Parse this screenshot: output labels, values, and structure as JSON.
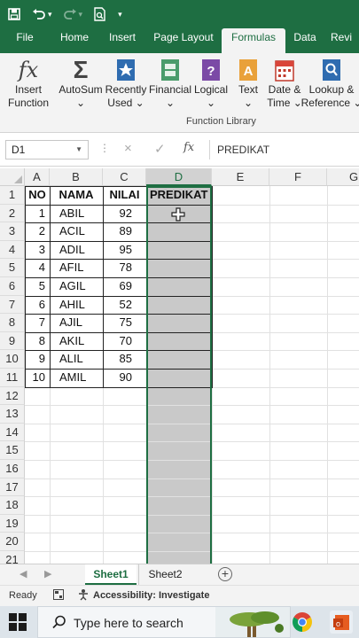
{
  "colors": {
    "accent": "#1e6e42",
    "ribbon_bg": "#f3f3f3",
    "selected_column": "#c9c9c9"
  },
  "qat": {
    "icons": [
      "save-icon",
      "undo-icon",
      "redo-icon",
      "print-preview-icon",
      "customize-caret-icon"
    ]
  },
  "tabs": [
    {
      "label": "File",
      "active": false
    },
    {
      "label": "Home",
      "active": false
    },
    {
      "label": "Insert",
      "active": false
    },
    {
      "label": "Page Layout",
      "active": false
    },
    {
      "label": "Formulas",
      "active": true
    },
    {
      "label": "Data",
      "active": false
    },
    {
      "label": "Revi",
      "active": false
    }
  ],
  "ribbon": {
    "group_label": "Function Library",
    "buttons": [
      {
        "line1": "Insert",
        "line2": "Function",
        "icon": "fx-icon"
      },
      {
        "line1": "AutoSum",
        "line2": "⌄",
        "icon": "sigma-icon"
      },
      {
        "line1": "Recently",
        "line2": "Used ⌄",
        "icon": "star-book-icon"
      },
      {
        "line1": "Financial",
        "line2": "⌄",
        "icon": "financial-book-icon"
      },
      {
        "line1": "Logical",
        "line2": "⌄",
        "icon": "logical-book-icon"
      },
      {
        "line1": "Text",
        "line2": "⌄",
        "icon": "text-book-icon"
      },
      {
        "line1": "Date &",
        "line2": "Time ⌄",
        "icon": "calendar-icon"
      },
      {
        "line1": "Lookup &",
        "line2": "Reference ⌄",
        "icon": "lookup-icon"
      }
    ]
  },
  "formula_bar": {
    "name_box": "D1",
    "cancel_icon": "×",
    "enter_icon": "✓",
    "fx_label": "fx",
    "content": "PREDIKAT"
  },
  "grid": {
    "columns": [
      "A",
      "B",
      "C",
      "D",
      "E",
      "F",
      "G"
    ],
    "selected_column": "D",
    "row_numbers": [
      "1",
      "2",
      "3",
      "4",
      "5",
      "6",
      "7",
      "8",
      "9",
      "10",
      "11",
      "12",
      "13",
      "14",
      "15",
      "16",
      "17",
      "18",
      "19",
      "20",
      "21"
    ],
    "headers": {
      "no": "NO",
      "nama": "NAMA",
      "nilai": "NILAI",
      "predikat": "PREDIKAT"
    },
    "rows": [
      {
        "no": "1",
        "nama": "ABIL",
        "nilai": "92"
      },
      {
        "no": "2",
        "nama": "ACIL",
        "nilai": "89"
      },
      {
        "no": "3",
        "nama": "ADIL",
        "nilai": "95"
      },
      {
        "no": "4",
        "nama": "AFIL",
        "nilai": "78"
      },
      {
        "no": "5",
        "nama": "AGIL",
        "nilai": "69"
      },
      {
        "no": "6",
        "nama": "AHIL",
        "nilai": "52"
      },
      {
        "no": "7",
        "nama": "AJIL",
        "nilai": "75"
      },
      {
        "no": "8",
        "nama": "AKIL",
        "nilai": "70"
      },
      {
        "no": "9",
        "nama": "ALIL",
        "nilai": "85"
      },
      {
        "no": "10",
        "nama": "AMIL",
        "nilai": "90"
      }
    ]
  },
  "sheets": [
    {
      "label": "Sheet1",
      "active": true
    },
    {
      "label": "Sheet2",
      "active": false
    }
  ],
  "status": {
    "ready": "Ready",
    "accessibility": "Accessibility: Investigate"
  },
  "taskbar": {
    "search_placeholder": "Type here to search"
  }
}
